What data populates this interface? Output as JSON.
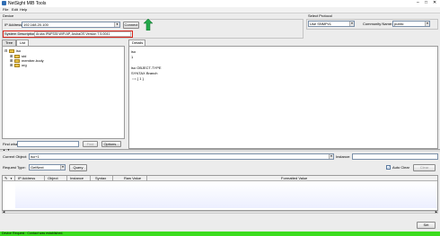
{
  "window": {
    "title": "NetSight MIB Tools"
  },
  "menu": [
    "File",
    "Edit",
    "Help"
  ],
  "device": {
    "group_label": "Device",
    "ip_label": "IP Address:",
    "ip_value": "192.168.20.100",
    "connect_label": "Connect",
    "sysdesc_label": "System Description:",
    "sysdesc_value": "Aruba IPAP335 WiFi AP, ArubaOS Version 7.5.0041"
  },
  "protocol": {
    "group_label": "Select Protocol",
    "protocol_value": "Use SNMPv1",
    "community_label": "Community Name:",
    "community_value": "public"
  },
  "left_tabs": [
    "Tree",
    "List"
  ],
  "tree": {
    "root": "iso",
    "children": [
      "std",
      "member-body",
      "org"
    ]
  },
  "find": {
    "label": "Find what:",
    "value": "",
    "find_button": "Find",
    "options_button": "Options..."
  },
  "details": {
    "tab": "Details",
    "lines": [
      "iso",
      "1",
      "",
      "iso OBJECT-TYPE",
      "SYNTAX Branch",
      " ::= { 1 }"
    ]
  },
  "request": {
    "current_object_label": "Current Object:",
    "current_object_value": "iso+1",
    "instance_label": "Instance:",
    "instance_value": "",
    "request_type_label": "Request Type:",
    "request_type_value": "GetNext",
    "query_label": "Query",
    "auto_clear_label": "Auto Clear",
    "auto_clear_checked": true,
    "clear_label": "Clear"
  },
  "results": {
    "columns": [
      "IP Address",
      "Object",
      "Instance",
      "Syntax",
      "Raw Value",
      "Formatted Value"
    ]
  },
  "set_button": "Set",
  "status": {
    "text": "Device Request : Contact was established."
  },
  "colors": {
    "status_bar": "#3cdc1e",
    "highlight_border": "#d9261c",
    "arrow_green": "#22a84a",
    "folder": "#e8c24a"
  }
}
